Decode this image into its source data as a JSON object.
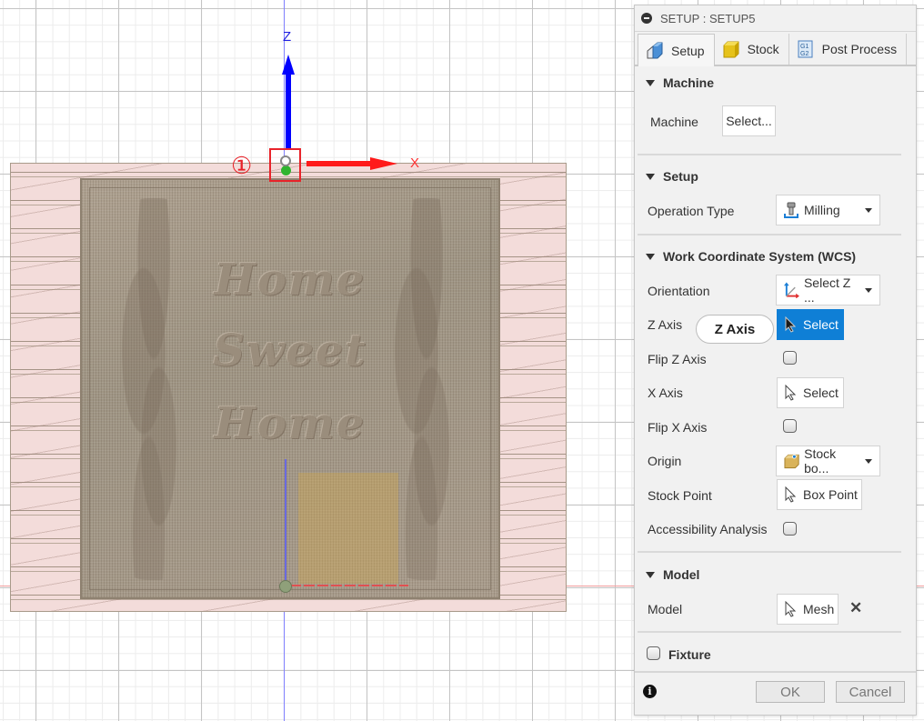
{
  "viewport": {
    "axis_z_label": "Z",
    "axis_x_label": "X",
    "step_marker": "①",
    "model_text_lines": [
      "Home",
      "Sweet",
      "Home"
    ],
    "colors": {
      "z_axis": "#0000ff",
      "x_axis": "#ff1a1a",
      "highlight_box": "#e8232a",
      "stock": "#f3dcda"
    }
  },
  "dialog": {
    "title": "SETUP : SETUP5",
    "tabs": [
      {
        "label": "Setup",
        "icon": "setup-cube-icon",
        "active": true
      },
      {
        "label": "Stock",
        "icon": "stock-box-icon",
        "active": false
      },
      {
        "label": "Post Process",
        "icon": "g1-g2-icon",
        "active": false
      }
    ],
    "sections": {
      "machine": {
        "title": "Machine",
        "machine_label": "Machine",
        "machine_button": "Select..."
      },
      "setup": {
        "title": "Setup",
        "operation_type_label": "Operation Type",
        "operation_type_value": "Milling"
      },
      "wcs": {
        "title": "Work Coordinate System (WCS)",
        "orientation_label": "Orientation",
        "orientation_value": "Select Z ...",
        "z_axis_label": "Z Axis",
        "z_axis_tooltip": "Z Axis",
        "z_axis_button": "Select",
        "flip_z_label": "Flip Z Axis",
        "flip_z_checked": false,
        "x_axis_label": "X Axis",
        "x_axis_button": "Select",
        "flip_x_label": "Flip X Axis",
        "flip_x_checked": false,
        "origin_label": "Origin",
        "origin_value": "Stock bo...",
        "stock_point_label": "Stock Point",
        "stock_point_button": "Box Point",
        "accessibility_label": "Accessibility Analysis",
        "accessibility_checked": false
      },
      "model": {
        "title": "Model",
        "model_label": "Model",
        "model_button": "Mesh"
      },
      "fixture": {
        "title": "Fixture",
        "checked": false
      }
    },
    "footer": {
      "ok_label": "OK",
      "cancel_label": "Cancel"
    },
    "accent_color": "#0f7fd6"
  }
}
